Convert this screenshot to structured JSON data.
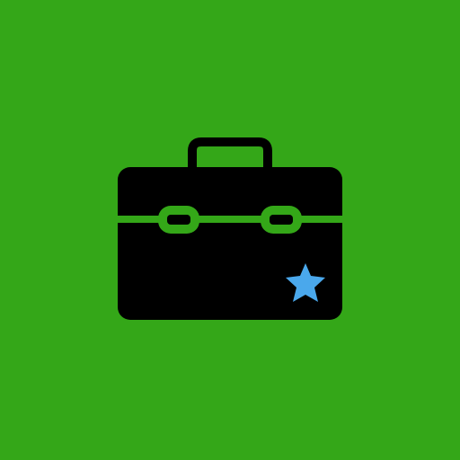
{
  "icon": {
    "name": "briefcase-star-icon",
    "subicons": {
      "briefcase": "briefcase-icon",
      "star": "star-icon"
    }
  },
  "colors": {
    "background": "#34a718",
    "briefcase": "#000000",
    "accent_band": "#34a718",
    "star": "#4aa8ec"
  }
}
